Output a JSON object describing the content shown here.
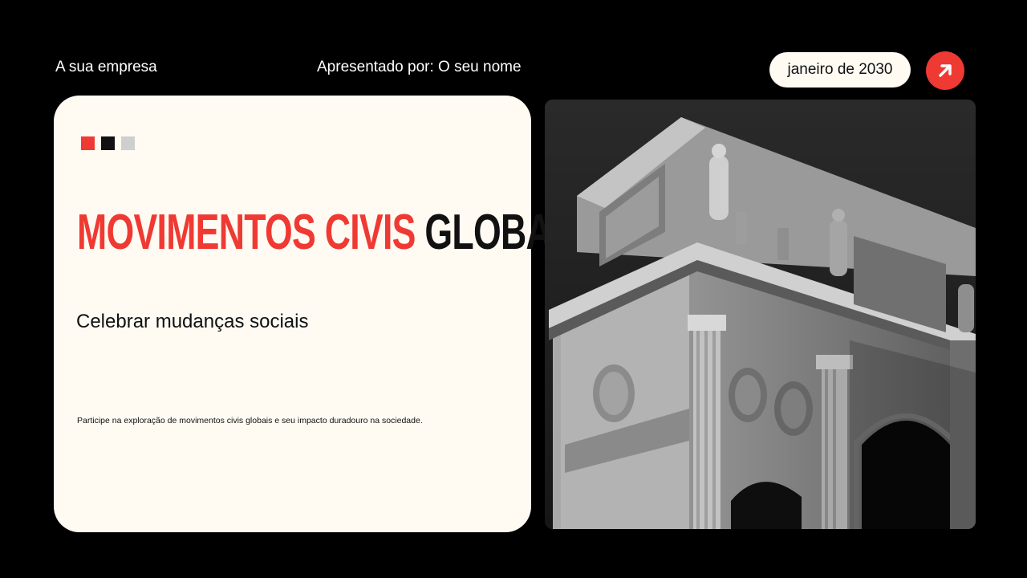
{
  "header": {
    "company": "A sua empresa",
    "presenter": "Apresentado por: O seu nome",
    "date": "janeiro de 2030"
  },
  "card": {
    "squares": [
      "#ef3a33",
      "#111111",
      "#cfcfcf"
    ],
    "title_red": "MOVIMENTOS CIVIS",
    "title_dark": "GLOBAIS",
    "subtitle": "Celebrar mudanças sociais",
    "blurb": "Participe na exploração de movimentos civis globais e seu impacto duradouro na sociedade."
  },
  "colors": {
    "background": "#000000",
    "card": "#fffbf3",
    "accent": "#ef3a33",
    "text_dark": "#111111"
  },
  "icons": {
    "nav_button": "arrow-up-right-icon"
  }
}
